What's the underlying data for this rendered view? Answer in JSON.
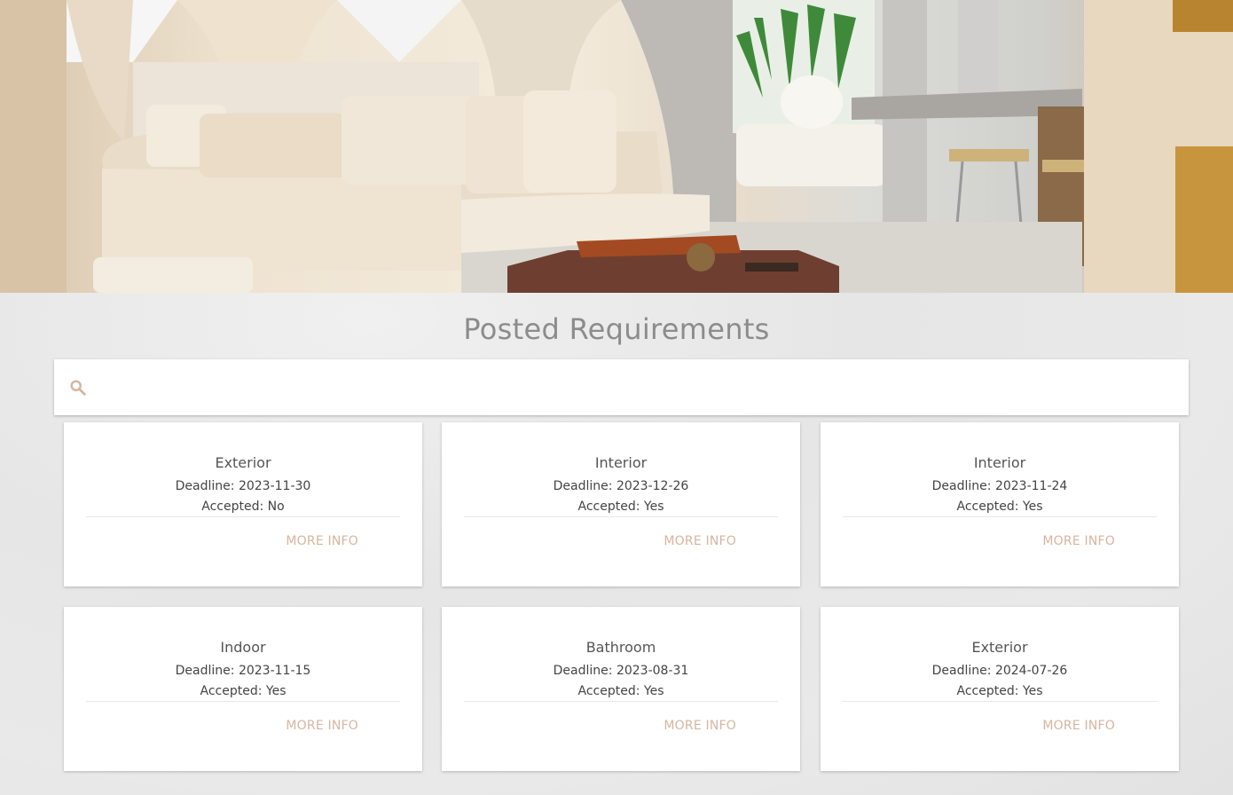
{
  "header": {
    "title": "Posted Requirements"
  },
  "search": {
    "value": "",
    "placeholder": ""
  },
  "labels": {
    "deadline": "Deadline:",
    "accepted": "Accepted:"
  },
  "cards": [
    {
      "category": "Exterior",
      "deadline": "2023-11-30",
      "accepted": "No",
      "action": "MORE INFO"
    },
    {
      "category": "Interior",
      "deadline": "2023-12-26",
      "accepted": "Yes",
      "action": "MORE INFO"
    },
    {
      "category": "Interior",
      "deadline": "2023-11-24",
      "accepted": "Yes",
      "action": "MORE INFO"
    },
    {
      "category": "Indoor",
      "deadline": "2023-11-15",
      "accepted": "Yes",
      "action": "MORE INFO"
    },
    {
      "category": "Bathroom",
      "deadline": "2023-08-31",
      "accepted": "Yes",
      "action": "MORE INFO"
    },
    {
      "category": "Exterior",
      "deadline": "2024-07-26",
      "accepted": "Yes",
      "action": "MORE INFO"
    }
  ],
  "colors": {
    "accent": "#d7b59f",
    "title": "#8c8c8c"
  }
}
